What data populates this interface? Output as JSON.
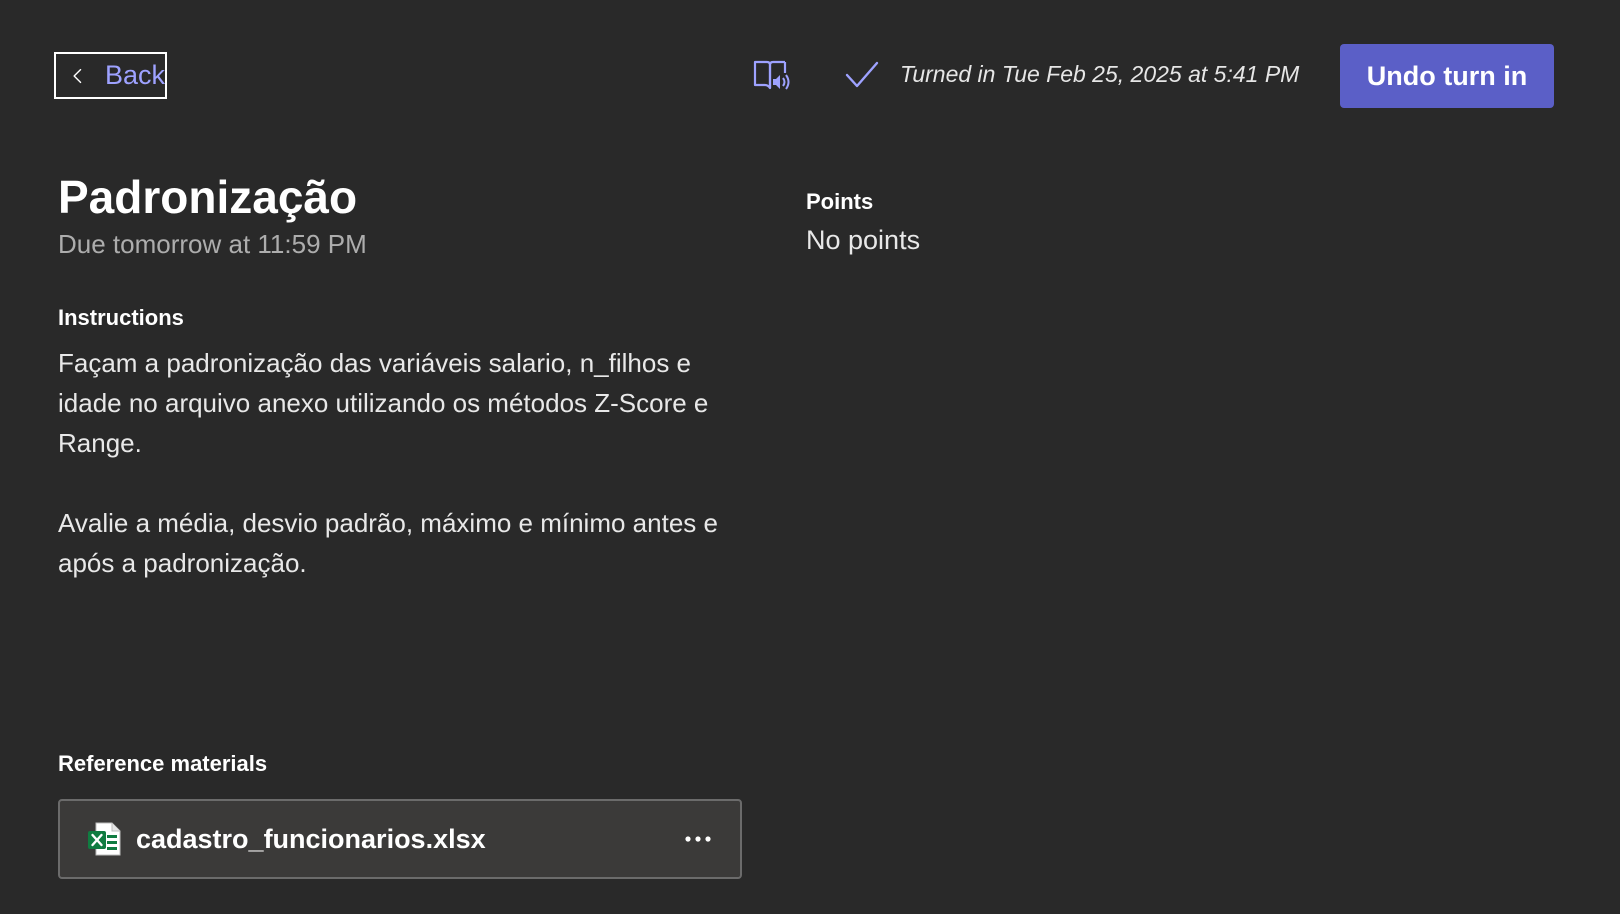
{
  "header": {
    "back_label": "Back",
    "turned_in_text": "Turned in Tue Feb 25, 2025 at 5:41 PM",
    "undo_label": "Undo turn in",
    "accent_color": "#5b5fc7"
  },
  "assignment": {
    "title": "Padronização",
    "due": "Due tomorrow at 11:59 PM",
    "instructions_heading": "Instructions",
    "instructions_paragraphs": [
      "Façam a padronização das variáveis salario, n_filhos e idade no arquivo anexo utilizando os métodos Z-Score e Range.",
      "Avalie a média, desvio padrão, máximo e mínimo antes e após a padronização."
    ]
  },
  "points": {
    "label": "Points",
    "value": "No points"
  },
  "reference": {
    "heading": "Reference materials",
    "files": [
      {
        "name": "cadastro_funcionarios.xlsx",
        "icon": "excel-file-icon"
      }
    ]
  },
  "icons": {
    "back": "chevron-left-icon",
    "reader": "immersive-reader-icon",
    "status": "checkmark-icon",
    "more": "more-options-icon"
  }
}
